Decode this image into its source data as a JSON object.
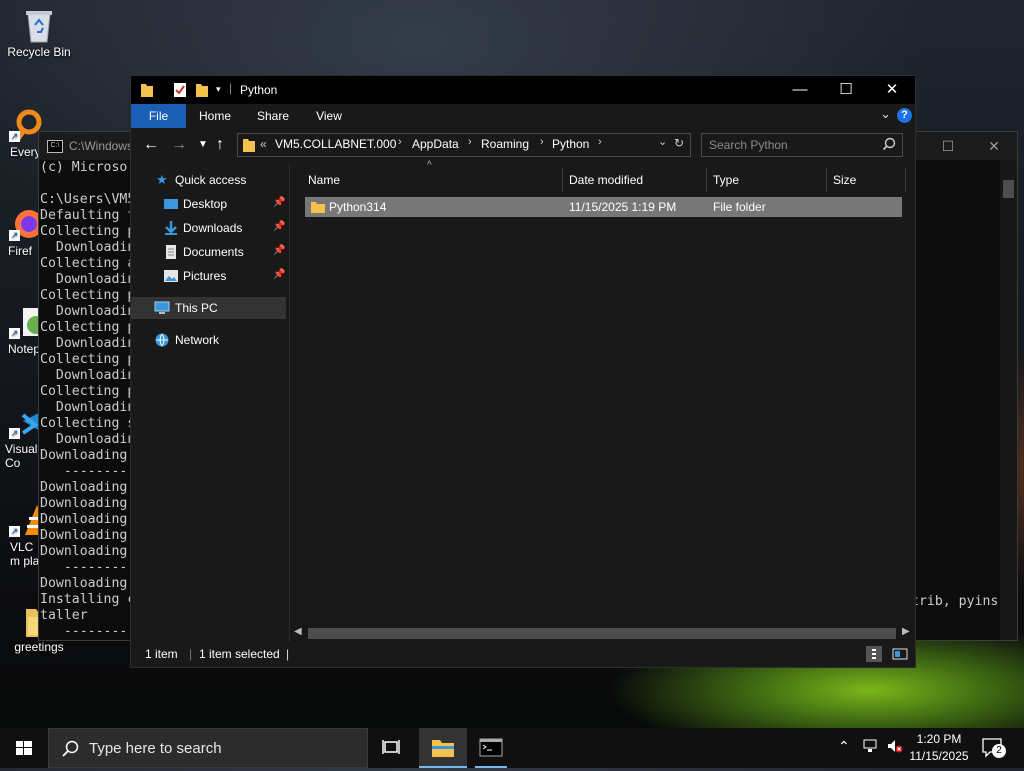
{
  "desktop": {
    "icons": [
      {
        "label": "Recycle Bin"
      },
      {
        "label": "Every"
      },
      {
        "label": "Firef"
      },
      {
        "label": "Notep"
      },
      {
        "label": "Visual Co"
      },
      {
        "label": "VLC m pla"
      },
      {
        "label": "greetings"
      }
    ]
  },
  "console": {
    "title": "C:\\Windows",
    "lines": [
      "(c) Microso",
      "",
      "C:\\Users\\VM5",
      "Defaulting t",
      "Collecting p",
      "  Downloadin",
      "Collecting a",
      "  Downloadin",
      "Collecting p",
      "  Downloadin",
      "Collecting p",
      "  Downloadin",
      "Collecting p",
      "  Downloadin",
      "Collecting p",
      "  Downloadin",
      "Collecting s",
      "  Downloadin",
      "Downloading",
      "   --------",
      "Downloading",
      "Downloading",
      "Downloading",
      "Downloading",
      "Downloading",
      "   --------",
      "Downloading",
      "Installing c",
      "taller",
      "   --------"
    ],
    "right_fragment": "trib, pyins"
  },
  "explorer": {
    "title": "Python",
    "ribbon_tabs": [
      "File",
      "Home",
      "Share",
      "View"
    ],
    "breadcrumb": [
      "VM5.COLLABNET.000",
      "AppData",
      "Roaming",
      "Python"
    ],
    "breadcrumb_overflow": "«",
    "search_placeholder": "Search Python",
    "nav": {
      "quick_access": "Quick access",
      "pinned": [
        "Desktop",
        "Downloads",
        "Documents",
        "Pictures"
      ],
      "this_pc": "This PC",
      "network": "Network"
    },
    "columns": [
      "Name",
      "Date modified",
      "Type",
      "Size"
    ],
    "files": [
      {
        "name": "Python314",
        "date": "11/15/2025 1:19 PM",
        "type": "File folder",
        "size": ""
      }
    ],
    "status": {
      "count": "1 item",
      "selected": "1 item selected"
    }
  },
  "taskbar": {
    "search_placeholder": "Type here to search",
    "time": "1:20 PM",
    "date": "11/15/2025",
    "notifications": "2"
  }
}
